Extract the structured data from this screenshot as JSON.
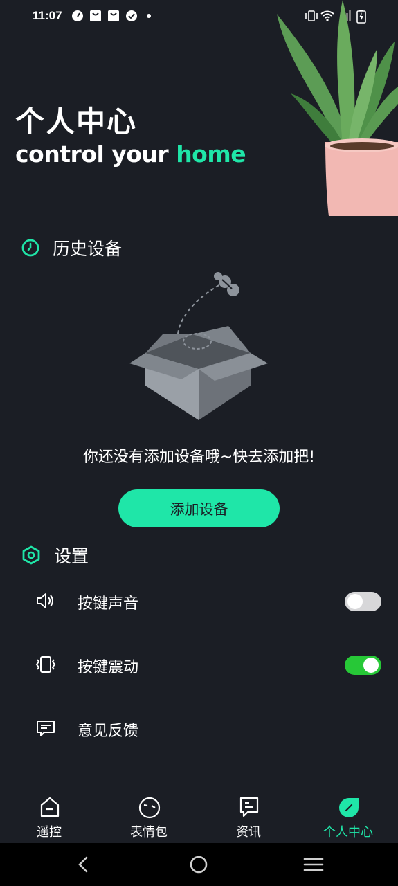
{
  "status_bar": {
    "time": "11:07",
    "icons_left": [
      "speed-icon",
      "bag-icon",
      "bag-icon",
      "check-circle-icon",
      "dot-icon"
    ],
    "icons_right": [
      "vibrate-icon",
      "wifi-icon",
      "signal-icon",
      "battery-charging-icon"
    ]
  },
  "header": {
    "title_cn": "个人中心",
    "subtitle_prefix": "control your ",
    "subtitle_accent": "home"
  },
  "history": {
    "title": "历史设备",
    "empty_text": "你还没有添加设备哦~快去添加把!",
    "add_button": "添加设备"
  },
  "settings": {
    "title": "设置",
    "items": [
      {
        "label": "按键声音",
        "icon": "speaker-icon",
        "toggle": false
      },
      {
        "label": "按键震动",
        "icon": "vibrate-icon",
        "toggle": true
      },
      {
        "label": "意见反馈",
        "icon": "feedback-icon"
      }
    ]
  },
  "tabs": [
    {
      "label": "遥控",
      "icon": "remote-icon",
      "active": false
    },
    {
      "label": "表情包",
      "icon": "emoji-icon",
      "active": false
    },
    {
      "label": "资讯",
      "icon": "news-icon",
      "active": false
    },
    {
      "label": "个人中心",
      "icon": "profile-icon",
      "active": true
    }
  ],
  "colors": {
    "background": "#1b1e25",
    "accent": "#1fe6a8",
    "toggle_on": "#27c837",
    "toggle_off": "#d7d7d9"
  }
}
